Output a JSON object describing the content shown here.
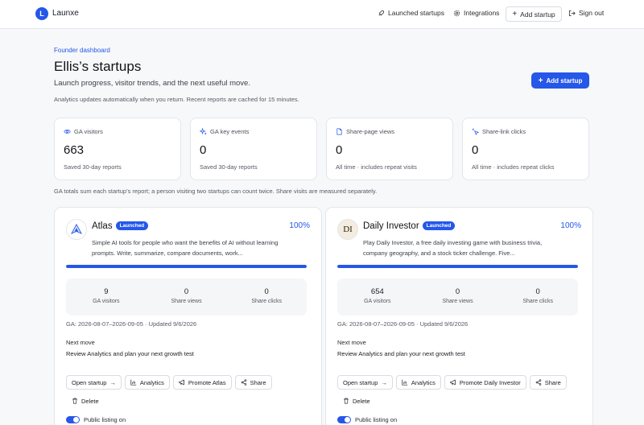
{
  "brand": {
    "logo_letter": "L",
    "name": "Launxe"
  },
  "nav": {
    "launched": "Launched startups",
    "integrations": "Integrations",
    "add": "Add startup",
    "signout": "Sign out"
  },
  "header": {
    "eyebrow": "Founder dashboard",
    "title": "Ellis’s startups",
    "subtitle": "Launch progress, visitor trends, and the next useful move.",
    "note": "Analytics updates automatically when you return. Recent reports are cached for 15 minutes.",
    "add_button": "Add startup"
  },
  "stats": [
    {
      "icon": "eye-icon",
      "label": "GA visitors",
      "value": "663",
      "sub": "Saved 30-day reports"
    },
    {
      "icon": "sparkle-icon",
      "label": "GA key events",
      "value": "0",
      "sub": "Saved 30-day reports"
    },
    {
      "icon": "file-icon",
      "label": "Share-page views",
      "value": "0",
      "sub": "All time · includes repeat visits"
    },
    {
      "icon": "cursor-click-icon",
      "label": "Share-link clicks",
      "value": "0",
      "sub": "All time · includes repeat clicks"
    }
  ],
  "disclaimer": "GA totals sum each startup’s report; a person visiting two startups can count twice. Share visits are measured separately.",
  "startups": [
    {
      "name": "Atlas",
      "badge": "Launched",
      "progress_label": "100%",
      "progress": 1.0,
      "description": "Simple AI tools for people who want the benefits of AI without learning prompts. Write, summarize, compare documents, work...",
      "metrics": [
        {
          "value": "9",
          "label": "GA visitors"
        },
        {
          "value": "0",
          "label": "Share views"
        },
        {
          "value": "0",
          "label": "Share clicks"
        }
      ],
      "range": "GA: 2026-08-07–2026-09-05 · Updated 9/6/2026",
      "next_move_label": "Next move",
      "next_move": "Review Analytics and plan your next growth test",
      "actions": {
        "open": "Open startup",
        "analytics": "Analytics",
        "promote": "Promote Atlas",
        "share": "Share",
        "delete": "Delete"
      },
      "toggle": "Public listing on"
    },
    {
      "name": "Daily Investor",
      "badge": "Launched",
      "progress_label": "100%",
      "progress": 1.0,
      "logo_text": "DI",
      "description": "Play Daily Investor, a free daily investing game with business trivia, company geography, and a stock ticker challenge. Five...",
      "metrics": [
        {
          "value": "654",
          "label": "GA visitors"
        },
        {
          "value": "0",
          "label": "Share views"
        },
        {
          "value": "0",
          "label": "Share clicks"
        }
      ],
      "range": "GA: 2026-08-07–2026-09-05 · Updated 9/6/2026",
      "next_move_label": "Next move",
      "next_move": "Review Analytics and plan your next growth test",
      "actions": {
        "open": "Open startup",
        "analytics": "Analytics",
        "promote": "Promote Daily Investor",
        "share": "Share",
        "delete": "Delete"
      },
      "toggle": "Public listing on"
    }
  ],
  "colors": {
    "accent": "#2557e8",
    "background": "#f7f8fa",
    "card": "#ffffff"
  }
}
